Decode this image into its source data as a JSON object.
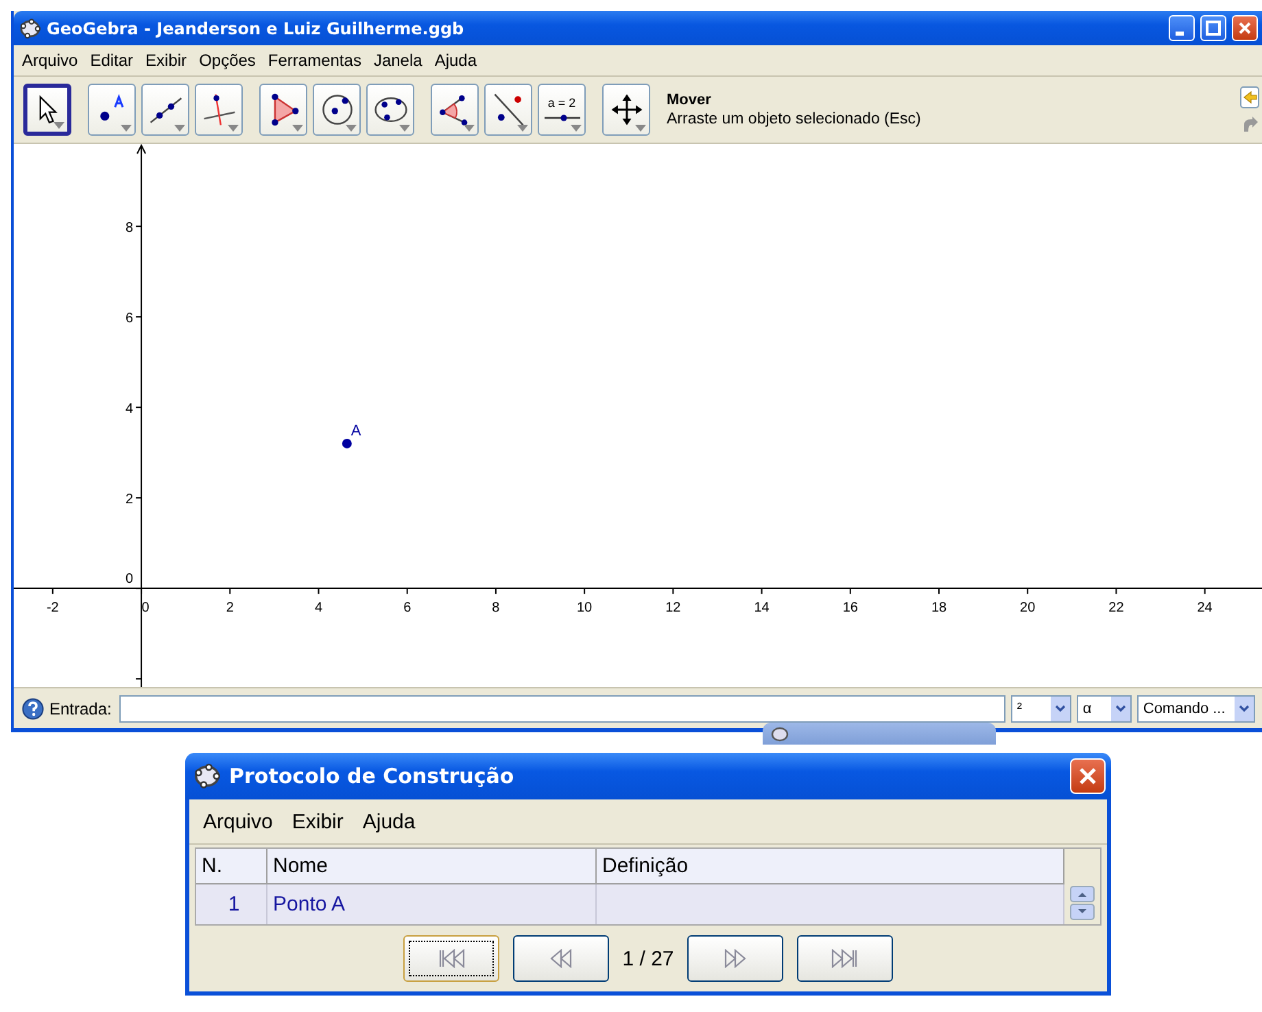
{
  "window": {
    "title": "GeoGebra - Jeanderson e Luiz Guilherme.ggb"
  },
  "menu": [
    "Arquivo",
    "Editar",
    "Exibir",
    "Opções",
    "Ferramentas",
    "Janela",
    "Ajuda"
  ],
  "toolbar": {
    "tool_groups": [
      [
        {
          "kind": "move",
          "selected": true
        }
      ],
      [
        {
          "kind": "point",
          "selected": false
        },
        {
          "kind": "line",
          "selected": false
        },
        {
          "kind": "perpendicular",
          "selected": false
        }
      ],
      [
        {
          "kind": "polygon",
          "selected": false
        },
        {
          "kind": "circle",
          "selected": false
        },
        {
          "kind": "conic",
          "selected": false
        }
      ],
      [
        {
          "kind": "angle",
          "selected": false
        },
        {
          "kind": "reflect",
          "selected": false
        },
        {
          "kind": "slider",
          "label": "a = 2",
          "selected": false
        }
      ],
      [
        {
          "kind": "move_view",
          "selected": false
        }
      ]
    ],
    "tool_name": "Mover",
    "tool_help": "Arraste um objeto selecionado (Esc)"
  },
  "graphics": {
    "chart_data": {
      "type": "scatter",
      "x": [
        4.64
      ],
      "series": [
        {
          "name": "A",
          "color": "#0000a0",
          "values": [
            3.2
          ]
        }
      ],
      "xlim": [
        -2.88,
        25.29
      ],
      "ylim": [
        -2.18,
        9.82
      ],
      "xticks": [
        -2,
        0,
        2,
        4,
        6,
        8,
        10,
        12,
        14,
        16,
        18,
        20,
        22,
        24
      ],
      "yticks": [
        0,
        2,
        4,
        6,
        8
      ]
    }
  },
  "input_bar": {
    "label": "Entrada:",
    "dropdowns": [
      "²",
      "α",
      "Comando ..."
    ]
  },
  "protocol": {
    "title": "Protocolo de Construção",
    "menu": [
      "Arquivo",
      "Exibir",
      "Ajuda"
    ],
    "columns": [
      "N.",
      "Nome",
      "Definição"
    ],
    "rows": [
      {
        "n": "1",
        "name": "Ponto A"
      }
    ],
    "position": "1 / 27"
  }
}
